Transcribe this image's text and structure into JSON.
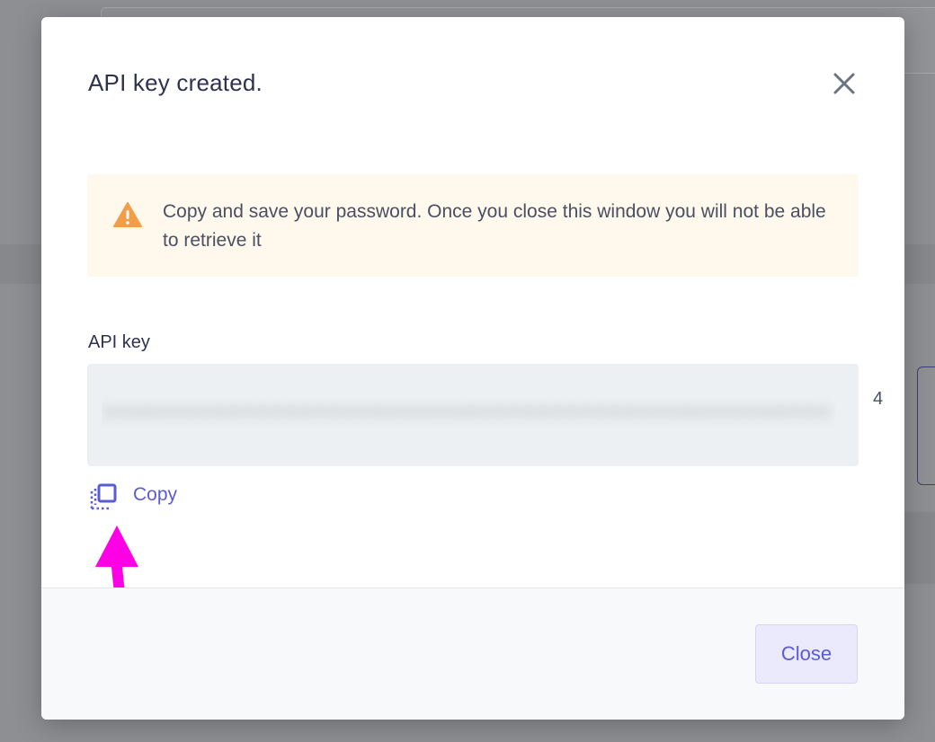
{
  "dialog": {
    "title": "API key created.",
    "alert": {
      "icon": "warning-triangle-icon",
      "message": "Copy and save your password. Once you close this window you will not be able to retrieve it"
    },
    "api_key": {
      "label": "API key",
      "value_blurred": "••••••••••••••••••••••••••••••••••••••••••••••••••••",
      "visible_tail": "4"
    },
    "copy_action": {
      "icon": "copy-icon",
      "label": "Copy"
    },
    "footer": {
      "close_label": "Close"
    }
  },
  "colors": {
    "accent": "#5b5bd6",
    "warning": "#f29d48",
    "annotation_arrow": "#ff00e6",
    "title_text": "#2e3250"
  }
}
